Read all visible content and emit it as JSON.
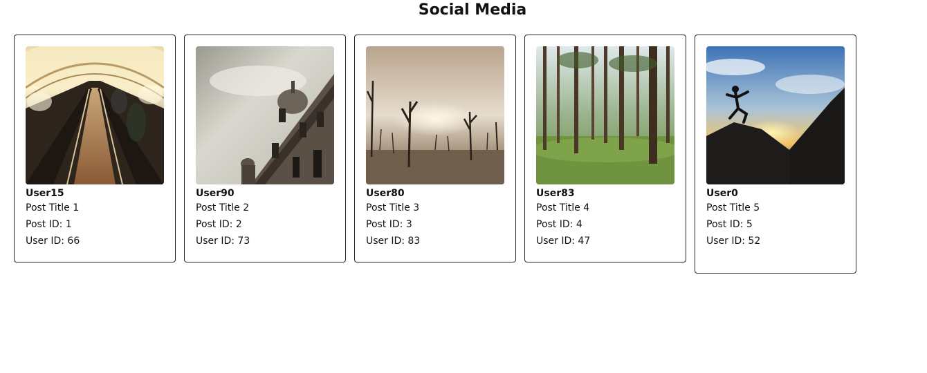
{
  "header": {
    "title": "Social Media"
  },
  "posts": [
    {
      "username": "User15",
      "title": "Post Title 1",
      "post_id": "Post ID: 1",
      "user_id": "User ID: 66",
      "image": "escalator-tunnel-photo"
    },
    {
      "username": "User90",
      "title": "Post Title 2",
      "post_id": "Post ID: 2",
      "user_id": "User ID: 73",
      "image": "domed-building-photo"
    },
    {
      "username": "User80",
      "title": "Post Title 3",
      "post_id": "Post ID: 3",
      "user_id": "User ID: 83",
      "image": "dead-trees-fog-photo"
    },
    {
      "username": "User83",
      "title": "Post Title 4",
      "post_id": "Post ID: 4",
      "user_id": "User ID: 47",
      "image": "pine-forest-photo"
    },
    {
      "username": "User0",
      "title": "Post Title 5",
      "post_id": "Post ID: 5",
      "user_id": "User ID: 52",
      "image": "jumping-silhouette-sunset-photo"
    }
  ]
}
